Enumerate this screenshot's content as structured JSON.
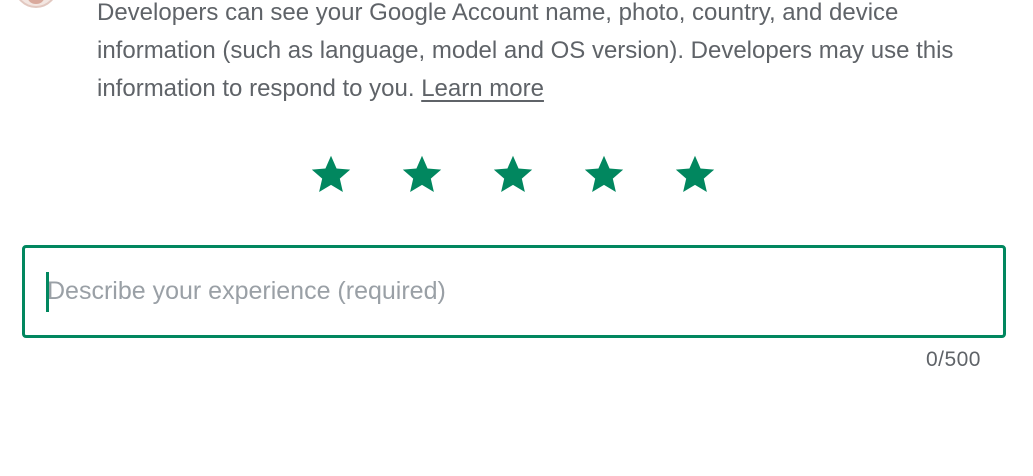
{
  "disclosure": {
    "text": "Developers can see your Google Account name, photo, country, and device information (such as language, model and OS version). Developers may use this information to respond to you.",
    "learn_more": "Learn more"
  },
  "rating": {
    "value": 5,
    "max": 5,
    "star_color": "#01875f"
  },
  "review": {
    "placeholder": "Describe your experience (required)",
    "value": "",
    "counter": "0/500",
    "border_color": "#01875f"
  }
}
